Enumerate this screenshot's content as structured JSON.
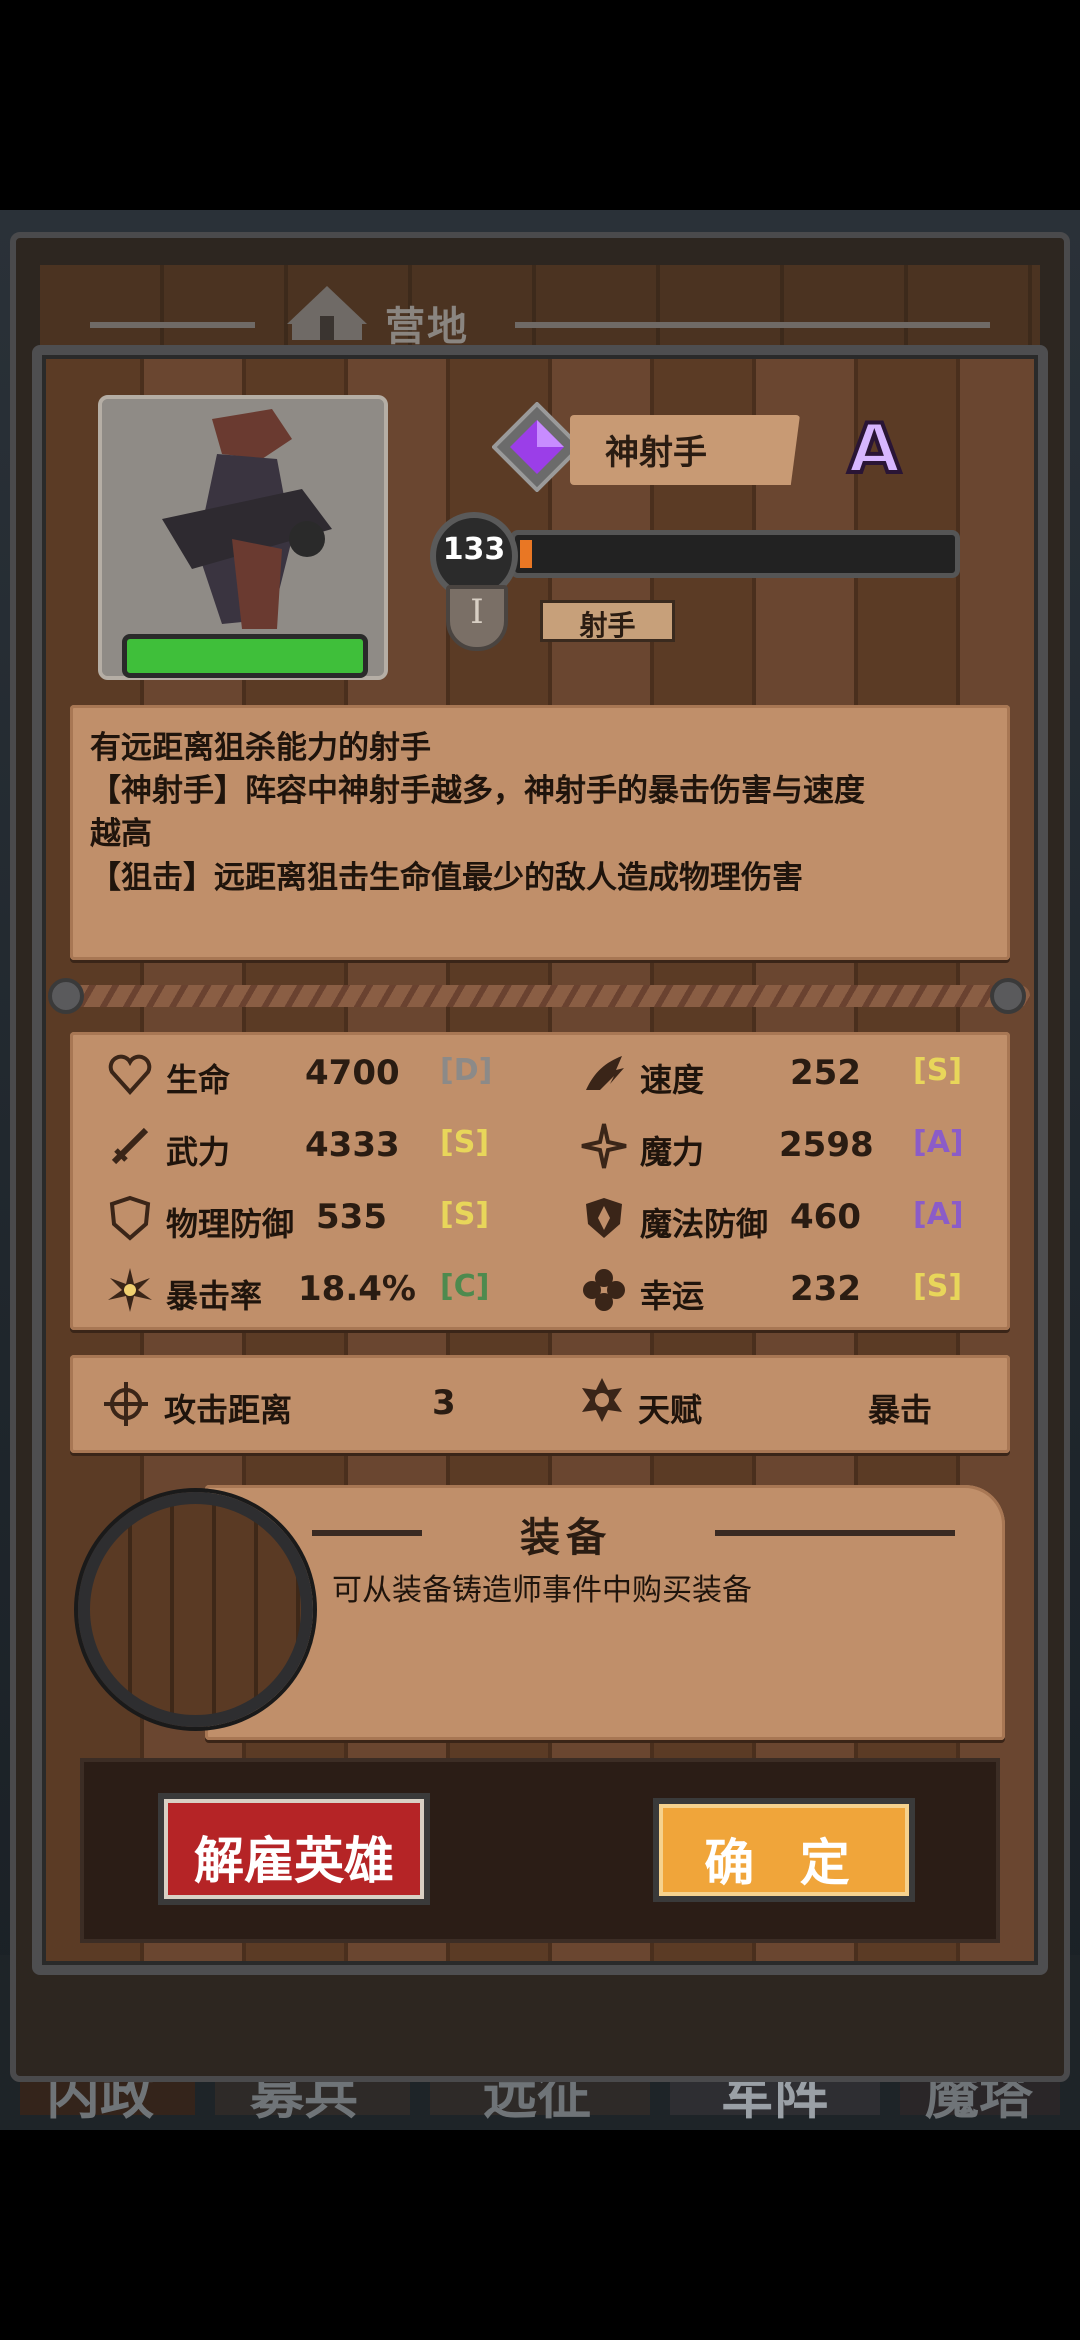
{
  "header": {
    "title": "营地"
  },
  "hero": {
    "class_name": "神射手",
    "grade": "A",
    "level": "133",
    "level_progress": 0.02,
    "rank": "I",
    "type": "射手",
    "hp_fraction": 1.0
  },
  "description": {
    "lines": [
      "有远距离狙杀能力的射手",
      "【神射手】阵容中神射手越多，神射手的暴击伤害与速度",
      "越高",
      "【狙击】远距离狙击生命值最少的敌人造成物理伤害"
    ]
  },
  "stats": {
    "left": [
      {
        "name": "生命",
        "value": "4700",
        "grade": "[D]",
        "icon": "heart-icon",
        "grade_color": "#8c8a88"
      },
      {
        "name": "武力",
        "value": "4333",
        "grade": "[S]",
        "icon": "sword-icon",
        "grade_color": "#e8d65a"
      },
      {
        "name": "物理防御",
        "value": "535",
        "grade": "[S]",
        "icon": "shield-icon",
        "grade_color": "#e8d65a"
      },
      {
        "name": "暴击率",
        "value": "18.4%",
        "grade": "[C]",
        "icon": "burst-icon",
        "grade_color": "#4e8a4e"
      }
    ],
    "right": [
      {
        "name": "速度",
        "value": "252",
        "grade": "[S]",
        "icon": "wind-icon",
        "grade_color": "#e8d65a"
      },
      {
        "name": "魔力",
        "value": "2598",
        "grade": "[A]",
        "icon": "sparkle-icon",
        "grade_color": "#8b5cc8"
      },
      {
        "name": "魔法防御",
        "value": "460",
        "grade": "[A]",
        "icon": "magic-shield-icon",
        "grade_color": "#8b5cc8"
      },
      {
        "name": "幸运",
        "value": "232",
        "grade": "[S]",
        "icon": "clover-icon",
        "grade_color": "#e8d65a"
      }
    ]
  },
  "extra": {
    "range_label": "攻击距离",
    "range_value": "3",
    "talent_label": "天赋",
    "talent_value": "暴击"
  },
  "equipment": {
    "title": "装备",
    "desc": "可从装备铸造师事件中购买装备"
  },
  "buttons": {
    "dismiss": "解雇英雄",
    "confirm": "确 定"
  },
  "nav": {
    "tabs": [
      "内政",
      "募兵",
      "远征",
      "军阵",
      "魔塔"
    ],
    "active": "军阵"
  }
}
